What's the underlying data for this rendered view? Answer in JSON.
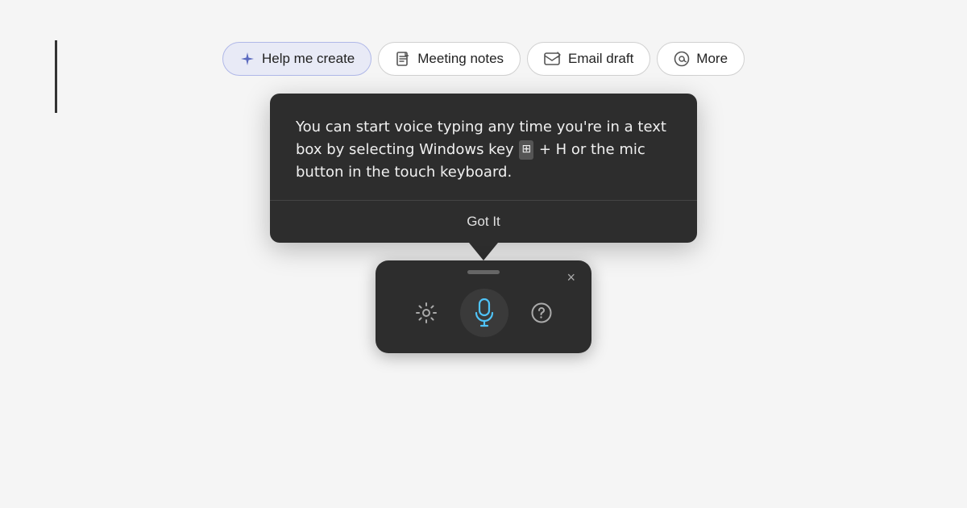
{
  "cursor": {
    "visible": true
  },
  "toolbar": {
    "buttons": [
      {
        "id": "help-me-create",
        "label": "Help me create",
        "icon": "sparkle",
        "active": true
      },
      {
        "id": "meeting-notes",
        "label": "Meeting notes",
        "icon": "document",
        "active": false
      },
      {
        "id": "email-draft",
        "label": "Email draft",
        "icon": "email",
        "active": false
      },
      {
        "id": "more",
        "label": "More",
        "icon": "at",
        "active": false
      }
    ]
  },
  "tooltip": {
    "text_part1": "You can start voice typing any time you’re in a text box by selecting Windows key",
    "text_part2": "+ H or the mic button in the touch keyboard.",
    "got_it_label": "Got It"
  },
  "voice_widget": {
    "close_label": "×"
  }
}
